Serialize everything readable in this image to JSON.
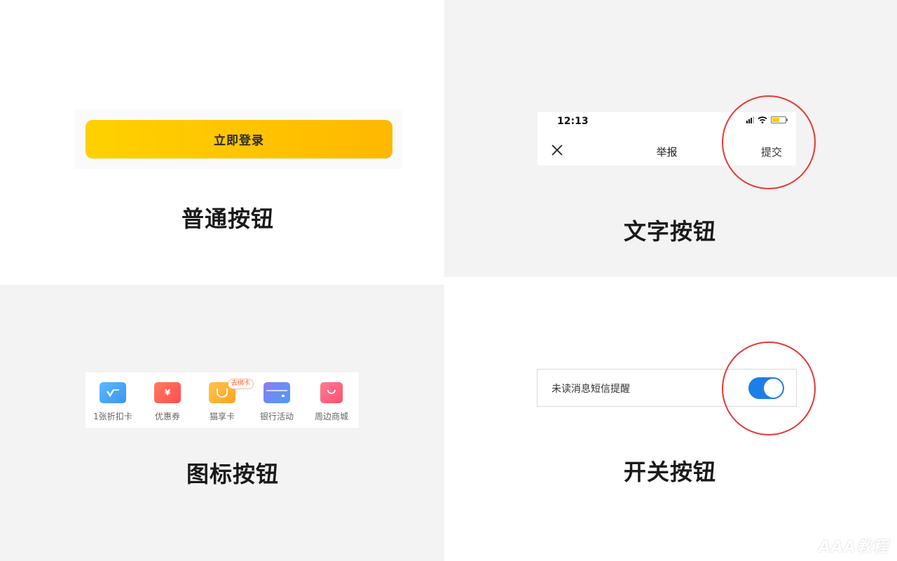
{
  "normal_button": {
    "button_label": "立即登录",
    "caption": "普通按钮",
    "gradient_start": "#ffd100",
    "gradient_end": "#ffb800"
  },
  "text_button": {
    "status_time": "12:13",
    "nav_title": "举报",
    "nav_action": "提交",
    "close_icon": "close-icon",
    "caption": "文字按钮"
  },
  "icon_button": {
    "items": [
      {
        "label": "1张折扣卡",
        "icon": "discount-card-icon",
        "color": "#4fa8f7"
      },
      {
        "label": "优惠券",
        "icon": "coupon-icon",
        "color": "#ff5d4f",
        "glyph": "¥"
      },
      {
        "label": "猫享卡",
        "icon": "cat-card-icon",
        "color": "#ffb33a",
        "badge": "去绑卡"
      },
      {
        "label": "银行活动",
        "icon": "bank-card-icon",
        "color": "#7d86f5"
      },
      {
        "label": "周边商城",
        "icon": "shopping-bag-icon",
        "color": "#ff6280"
      }
    ],
    "caption": "图标按钮"
  },
  "switch_button": {
    "label": "未读消息短信提醒",
    "state": "on",
    "on_color": "#1e7ee8",
    "caption": "开关按钮"
  },
  "highlight_color": "#e53935",
  "watermark": "AAA教程"
}
